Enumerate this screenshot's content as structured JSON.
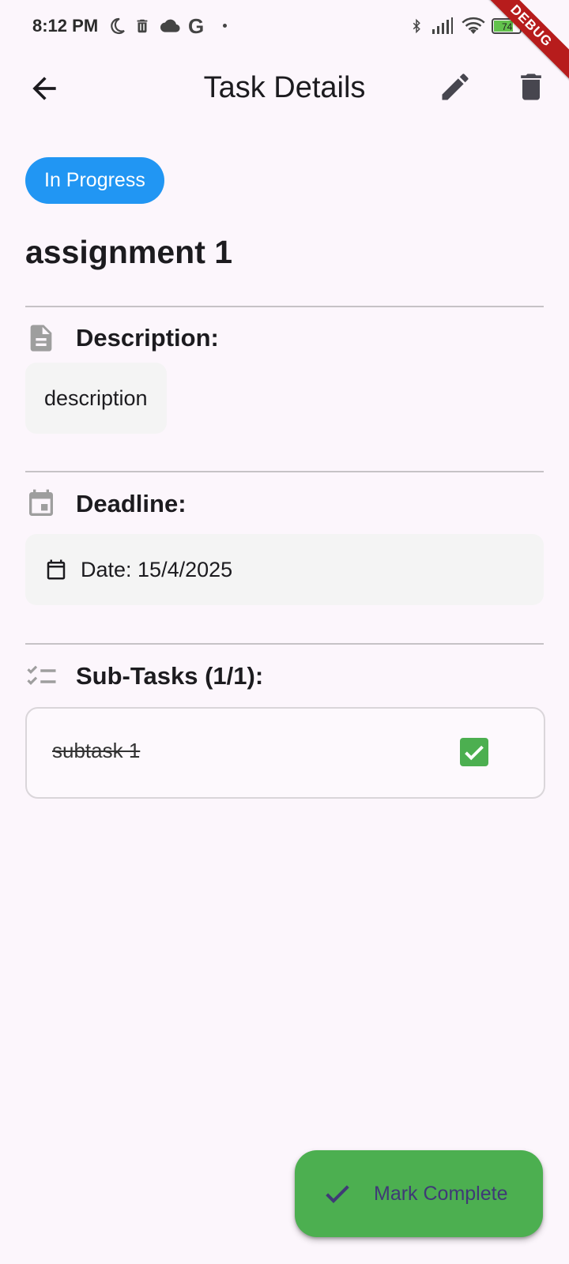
{
  "status_bar": {
    "time": "8:12 PM",
    "left_icons": [
      "moon-icon",
      "trash-notification-icon",
      "cloud-icon",
      "google-icon",
      "dot-icon"
    ],
    "right_icons": [
      "bluetooth-icon",
      "cellular-signal-icon",
      "wifi-icon",
      "battery-icon",
      "charging-icon"
    ],
    "battery_level": "74"
  },
  "debug_banner": "DEBUG",
  "app_bar": {
    "title": "Task Details",
    "back_icon": "arrow-back-icon",
    "edit_icon": "pencil-icon",
    "delete_icon": "trash-icon"
  },
  "task": {
    "status": "In Progress",
    "status_color": "#2196F3",
    "title": "assignment 1"
  },
  "description": {
    "label": "Description:",
    "icon": "document-icon",
    "text": "description"
  },
  "deadline": {
    "label": "Deadline:",
    "icon": "calendar-icon",
    "date_text": "Date: 15/4/2025"
  },
  "subtasks": {
    "label": "Sub-Tasks (1/1):",
    "icon": "checklist-icon",
    "items": [
      {
        "name": "subtask 1",
        "done": true
      }
    ]
  },
  "fab": {
    "label": "Mark Complete",
    "icon": "check-icon",
    "color": "#4CAF50"
  }
}
